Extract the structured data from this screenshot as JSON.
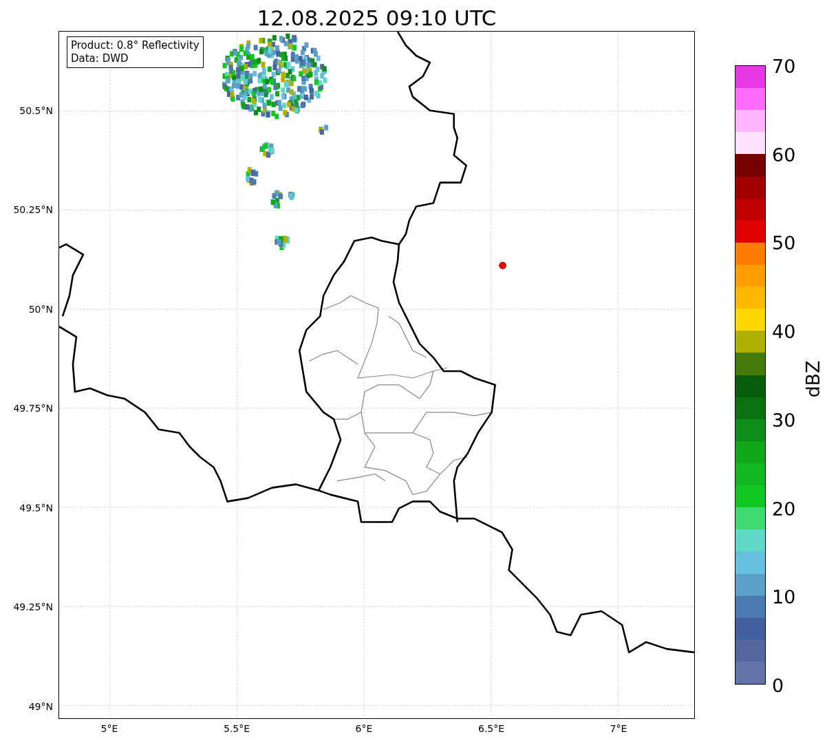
{
  "title": "12.08.2025 09:10 UTC",
  "info_box": [
    "Product: 0.8° Reflectivity",
    "Data: DWD"
  ],
  "y_ticks": [
    "50.5°N",
    "50.25°N",
    "50°N",
    "49.75°N",
    "49.5°N",
    "49.25°N",
    "49°N"
  ],
  "x_ticks": [
    "5°E",
    "5.5°E",
    "6°E",
    "6.5°E",
    "7°E"
  ],
  "colorbar": {
    "label": "dBZ",
    "ticks": [
      "70",
      "60",
      "50",
      "40",
      "30",
      "20",
      "10",
      "0"
    ],
    "bands": [
      {
        "color": "#e838e8"
      },
      {
        "color": "#ff6cff"
      },
      {
        "color": "#ffb4ff"
      },
      {
        "color": "#ffe0ff"
      },
      {
        "color": "#780000"
      },
      {
        "color": "#a00000"
      },
      {
        "color": "#c00000"
      },
      {
        "color": "#e00000"
      },
      {
        "color": "#ff7c00"
      },
      {
        "color": "#ff9c00"
      },
      {
        "color": "#ffb800"
      },
      {
        "color": "#ffd800"
      },
      {
        "color": "#b0b000"
      },
      {
        "color": "#467a0a"
      },
      {
        "color": "#085c0c"
      },
      {
        "color": "#0a7010"
      },
      {
        "color": "#0c8c18"
      },
      {
        "color": "#10a818"
      },
      {
        "color": "#10b820"
      },
      {
        "color": "#10c820"
      },
      {
        "color": "#40d870"
      },
      {
        "color": "#60d8c8"
      },
      {
        "color": "#64c0dc"
      },
      {
        "color": "#5aa0c8"
      },
      {
        "color": "#4a7ab0"
      },
      {
        "color": "#4460a0"
      },
      {
        "color": "#5468a0"
      },
      {
        "color": "#6474a8"
      }
    ]
  }
}
